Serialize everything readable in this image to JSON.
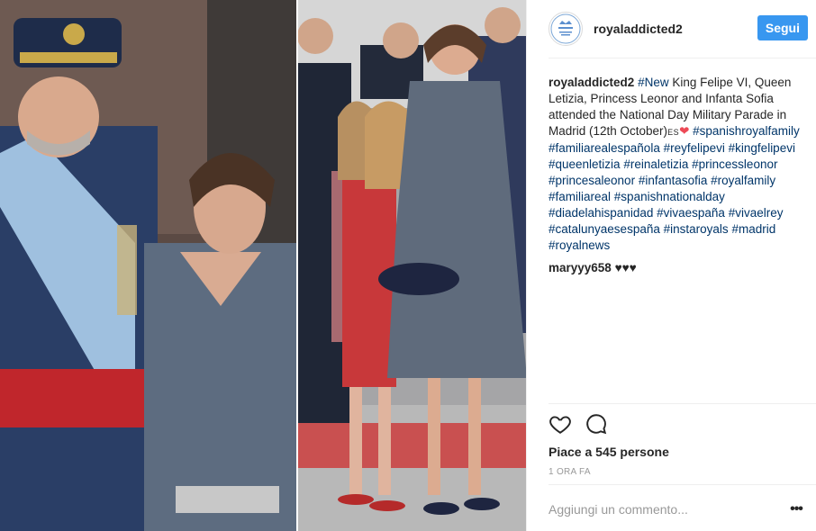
{
  "post": {
    "account": {
      "username": "royaladdicted2",
      "avatar_text": "Royal Addicted",
      "follow_label": "Segui"
    },
    "caption": {
      "username": "royaladdicted2",
      "tag": "#New",
      "text": " King Felipe VI, Queen Letizia, Princess Leonor and Infanta Sofia attended the National Day Military Parade in Madrid (12th October)",
      "flag_text": "ES",
      "heart": "❤",
      "hashtags": [
        "#spanishroyalfamily",
        "#familiarealespañola",
        "#reyfelipevi",
        "#kingfelipevi",
        "#queenletizia",
        "#reinaletizia",
        "#princessleonor",
        "#princesaleonor",
        "#infantasofia",
        "#royalfamily",
        "#familiareal",
        "#spanishnationalday",
        "#diadelahispanidad",
        "#vivaespaña",
        "#vivaelrey",
        "#catalunyaesespaña",
        "#instaroyals",
        "#madrid",
        "#royalnews"
      ]
    },
    "comments": [
      {
        "username": "maryyy658",
        "text": "♥♥♥"
      }
    ],
    "actions": {
      "like_icon": "heart-outline-icon",
      "comment_icon": "speech-bubble-icon"
    },
    "likes_text": "Piace a 545 persone",
    "timestamp": "1 ORA FA",
    "add_comment_placeholder": "Aggiungi un commento...",
    "more_icon": "ellipsis-icon"
  },
  "colors": {
    "follow_button": "#3897f0",
    "hashtag": "#003569",
    "heart": "#ed4956",
    "muted": "#999999"
  }
}
